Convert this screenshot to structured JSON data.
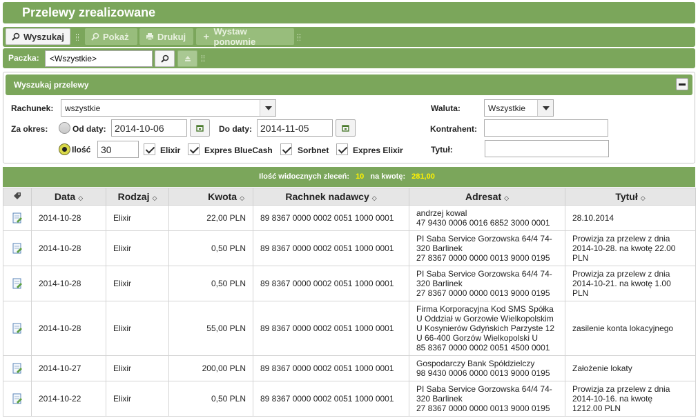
{
  "header": {
    "title": "Przelewy zrealizowane"
  },
  "toolbar": {
    "search": "Wyszukaj",
    "show": "Pokaż",
    "print": "Drukuj",
    "reissue": "Wystaw ponownie"
  },
  "batch": {
    "label": "Paczka:",
    "value": "<Wszystkie>"
  },
  "search_panel": {
    "title": "Wyszukaj przelewy",
    "account_label": "Rachunek:",
    "account_value": "wszystkie",
    "period_label": "Za okres:",
    "from_label": "Od daty:",
    "from_value": "2014-10-06",
    "to_label": "Do daty:",
    "to_value": "2014-11-05",
    "count_label": "Ilość",
    "count_value": "30",
    "checkboxes": [
      "Elixir",
      "Expres BlueCash",
      "Sorbnet",
      "Expres Elixir"
    ],
    "currency_label": "Waluta:",
    "currency_value": "Wszystkie",
    "counterparty_label": "Kontrahent:",
    "title_label": "Tytuł:"
  },
  "summary": {
    "visible_label": "Ilość widocznych zleceń:",
    "visible_count": "10",
    "amount_label": "na kwotę:",
    "amount_value": "281,00"
  },
  "table": {
    "columns": [
      "Data",
      "Rodzaj",
      "Kwota",
      "Rachnek nadawcy",
      "Adresat",
      "Tytuł"
    ],
    "rows": [
      {
        "date": "2014-10-28",
        "type": "Elixir",
        "amount": "22,00 PLN",
        "sender": "89 8367 0000 0002 0051 1000 0001",
        "recipient": [
          "andrzej kowal",
          "47 9430 0006 0016 6852 3000 0001"
        ],
        "title": [
          "28.10.2014"
        ]
      },
      {
        "date": "2014-10-28",
        "type": "Elixir",
        "amount": "0,50 PLN",
        "sender": "89 8367 0000 0002 0051 1000 0001",
        "recipient": [
          "PI Saba Service Gorzowska 64/4 74-",
          "320 Barlinek",
          "27 8367 0000 0000 0013 9000 0195"
        ],
        "title": [
          "Prowizja za przelew z dnia",
          "2014-10-28. na kwotę 22.00",
          "PLN"
        ]
      },
      {
        "date": "2014-10-28",
        "type": "Elixir",
        "amount": "0,50 PLN",
        "sender": "89 8367 0000 0002 0051 1000 0001",
        "recipient": [
          "PI Saba Service Gorzowska 64/4 74-",
          "320 Barlinek",
          "27 8367 0000 0000 0013 9000 0195"
        ],
        "title": [
          "Prowizja za przelew z dnia",
          "2014-10-21. na kwotę 1.00",
          "PLN"
        ]
      },
      {
        "date": "2014-10-28",
        "type": "Elixir",
        "amount": "55,00 PLN",
        "sender": "89 8367 0000 0002 0051 1000 0001",
        "recipient": [
          "Firma Korporacyjna Kod SMS Spółka",
          "U Oddział w Gorzowie Wielkopolskim",
          "U Kosynierów Gdyńskich Parzyste 12",
          "U 66-400 Gorzów Wielkopolski U",
          "85 8367 0000 0002 0051 4500 0001"
        ],
        "title": [
          "zasilenie konta lokacyjnego"
        ]
      },
      {
        "date": "2014-10-27",
        "type": "Elixir",
        "amount": "200,00 PLN",
        "sender": "89 8367 0000 0002 0051 1000 0001",
        "recipient": [
          "Gospodarczy Bank Spółdzielczy",
          "98 9430 0006 0000 0013 9000 0195"
        ],
        "title": [
          "Założenie lokaty"
        ]
      },
      {
        "date": "2014-10-22",
        "type": "Elixir",
        "amount": "0,50 PLN",
        "sender": "89 8367 0000 0002 0051 1000 0001",
        "recipient": [
          "PI Saba Service Gorzowska 64/4 74-",
          "320 Barlinek",
          "27 8367 0000 0000 0013 9000 0195"
        ],
        "title": [
          "Prowizja za przelew z dnia",
          "2014-10-16. na kwotę",
          "1212.00 PLN"
        ]
      }
    ]
  },
  "colors": {
    "accent": "#7ba65b",
    "highlight": "#fff200"
  }
}
